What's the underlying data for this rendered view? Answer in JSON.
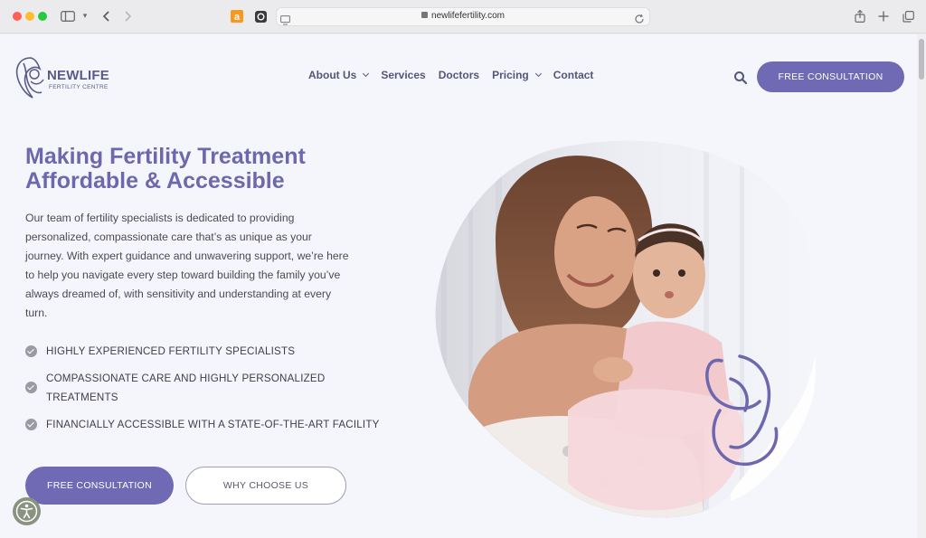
{
  "browser": {
    "url": "newlifefertility.com",
    "icons": [
      "sidebar-icon",
      "back-icon",
      "forward-icon",
      "amazon-icon",
      "extension-icon",
      "reader-icon",
      "reload-icon",
      "share-icon",
      "new-tab-icon",
      "tabs-icon"
    ]
  },
  "header": {
    "logo": {
      "brand": "NEWLIFE",
      "sub": "FERTILITY CENTRE"
    },
    "nav": [
      {
        "label": "About Us",
        "dropdown": true
      },
      {
        "label": "Services",
        "dropdown": false
      },
      {
        "label": "Doctors",
        "dropdown": false
      },
      {
        "label": "Pricing",
        "dropdown": true
      },
      {
        "label": "Contact",
        "dropdown": false
      }
    ],
    "cta_label": "FREE CONSULTATION"
  },
  "hero": {
    "title_line1": "Making Fertility Treatment",
    "title_line2": "Affordable & Accessible",
    "description": "Our team of fertility specialists is dedicated to providing personalized, compassionate care that’s as unique as your journey. With expert guidance and unwavering support, we’re here to help you navigate every step toward building the family you’ve always dreamed of, with sensitivity and understanding at every turn.",
    "features": [
      "HIGHLY EXPERIENCED FERTILITY SPECIALISTS",
      "COMPASSIONATE CARE AND HIGHLY PERSONALIZED TREATMENTS",
      "FINANCIALLY ACCESSIBLE WITH A STATE-OF-THE-ART FACILITY"
    ],
    "primary_cta": "FREE CONSULTATION",
    "secondary_cta": "WHY CHOOSE US"
  },
  "colors": {
    "accent": "#7069b3",
    "heading": "#6d68ad",
    "page_bg": "#f5f6fc",
    "text": "#4a4a55"
  }
}
